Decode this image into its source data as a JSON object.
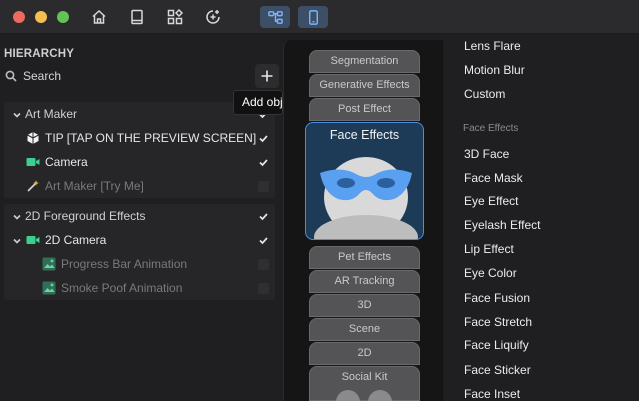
{
  "hierarchy": {
    "title": "HIERARCHY",
    "search_label": "Search",
    "add_tooltip": "Add object",
    "groups": [
      {
        "label": "Art Maker",
        "items": [
          {
            "label": "TIP [TAP ON THE PREVIEW SCREEN]",
            "checked": true,
            "dim": false
          },
          {
            "label": "Camera",
            "checked": true,
            "dim": false
          },
          {
            "label": "Art Maker [Try Me]",
            "checked": false,
            "dim": true
          }
        ]
      },
      {
        "label": "2D Foreground Effects",
        "items": [
          {
            "label": "2D Camera",
            "checked": true,
            "dim": false
          },
          {
            "label": "Progress Bar Animation",
            "checked": false,
            "dim": true
          },
          {
            "label": "Smoke Poof Animation",
            "checked": false,
            "dim": true
          }
        ]
      }
    ]
  },
  "categories": {
    "above": [
      "Segmentation",
      "Generative Effects",
      "Post Effect"
    ],
    "selected": "Face Effects",
    "below": [
      "Pet Effects",
      "AR Tracking",
      "3D",
      "Scene",
      "2D",
      "Social Kit"
    ]
  },
  "effects": {
    "top_items": [
      "Lens Flare",
      "Motion Blur",
      "Custom"
    ],
    "face_header": "Face Effects",
    "face_items": [
      "3D Face",
      "Face Mask",
      "Eye Effect",
      "Eyelash Effect",
      "Lip Effect",
      "Eye Color",
      "Face Fusion",
      "Face Stretch",
      "Face Liquify",
      "Face Sticker",
      "Face Inset"
    ]
  },
  "colors": {
    "accent": "#4b8ee0",
    "camera_icon": "#3ccf91",
    "mask": "#5aa0f0"
  }
}
